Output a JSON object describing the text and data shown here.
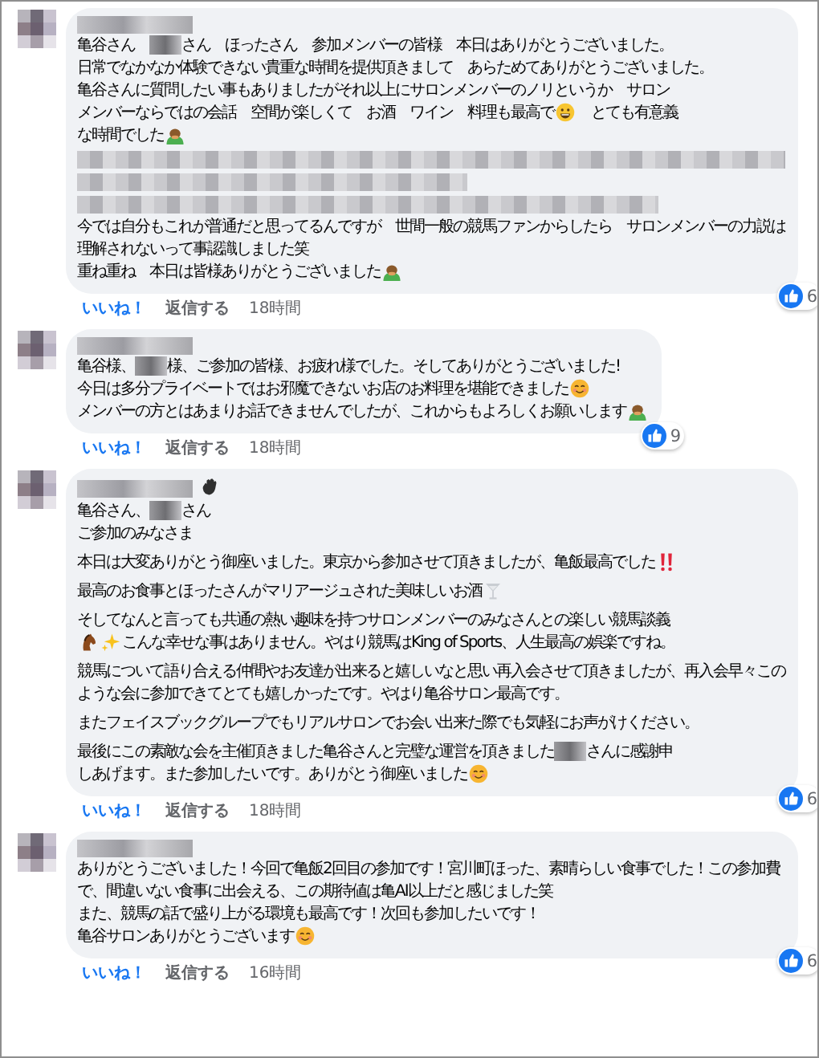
{
  "comments": [
    {
      "paragraphs": [
        [
          {
            "kind": "text",
            "segments": [
              {
                "kind": "text",
                "text": "亀谷さん　"
              },
              {
                "kind": "redacted"
              },
              {
                "kind": "text",
                "text": "さん　ほったさん　参加メンバーの皆様　本日はありがとうございました。"
              }
            ]
          },
          {
            "kind": "text",
            "segments": [
              {
                "kind": "text",
                "text": "日常でなかなか体験できない貴重な時間を提供頂きまして　あらためてありがとうございました。"
              }
            ]
          },
          {
            "kind": "text",
            "segments": [
              {
                "kind": "text",
                "text": "亀谷さんに質問したい事もありましたがそれ以上にサロンメンバーのノリというか　サロン"
              }
            ]
          },
          {
            "kind": "text",
            "segments": [
              {
                "kind": "text",
                "text": "メンバーならではの会話　空間が楽しくて　お酒　ワイン　料理も最高で"
              },
              {
                "kind": "grin"
              },
              {
                "kind": "text",
                "text": "　とても有意義"
              }
            ]
          },
          {
            "kind": "text",
            "segments": [
              {
                "kind": "text",
                "text": "な時間でした"
              },
              {
                "kind": "bow"
              }
            ]
          },
          {
            "kind": "redacted"
          },
          {
            "kind": "text",
            "segments": [
              {
                "kind": "text",
                "text": "今では自分もこれが普通だと思ってるんですが　世間一般の競馬ファンからしたら　サロンメンバーの力説は理解されないって事認識しました笑"
              }
            ]
          },
          {
            "kind": "text",
            "segments": [
              {
                "kind": "text",
                "text": "重ね重ね　本日は皆様ありがとうございました"
              },
              {
                "kind": "bow"
              }
            ]
          }
        ]
      ],
      "like": "いいね！",
      "reply": "返信する",
      "time": "18時間",
      "reactions": "6"
    },
    {
      "paragraphs": [
        [
          {
            "kind": "text",
            "segments": [
              {
                "kind": "text",
                "text": "亀谷様、"
              },
              {
                "kind": "redacted"
              },
              {
                "kind": "text",
                "text": "様、ご参加の皆様、お疲れ様でした。そしてありがとうございました!"
              }
            ]
          },
          {
            "kind": "text",
            "segments": [
              {
                "kind": "text",
                "text": "今日は多分プライベートではお邪魔できないお店のお料理を堪能できました"
              },
              {
                "kind": "smile"
              }
            ]
          },
          {
            "kind": "text",
            "segments": [
              {
                "kind": "text",
                "text": "メンバーの方とはあまりお話できませんでしたが、これからもよろしくお願いします"
              },
              {
                "kind": "bow"
              }
            ]
          }
        ]
      ],
      "like": "いいね！",
      "reply": "返信する",
      "time": "18時間",
      "reactions": "9"
    },
    {
      "author_badge": {
        "kind": "wave"
      },
      "paragraphs": [
        [
          {
            "kind": "text",
            "segments": [
              {
                "kind": "text",
                "text": "亀谷さん、"
              },
              {
                "kind": "redacted"
              },
              {
                "kind": "text",
                "text": "さん"
              }
            ]
          },
          {
            "kind": "text",
            "segments": [
              {
                "kind": "text",
                "text": "ご参加のみなさま"
              }
            ]
          }
        ],
        [
          {
            "kind": "text",
            "segments": [
              {
                "kind": "text",
                "text": "本日は大変ありがとう御座いました。東京から参加させて頂きましたが、亀飯最高でした"
              },
              {
                "kind": "exclaim"
              }
            ]
          }
        ],
        [
          {
            "kind": "text",
            "segments": [
              {
                "kind": "text",
                "text": "最高のお食事とほったさんがマリアージュされた美味しいお酒"
              },
              {
                "kind": "glass"
              }
            ]
          }
        ],
        [
          {
            "kind": "text",
            "segments": [
              {
                "kind": "text",
                "text": "そしてなんと言っても共通の熱い趣味を持つサロンメンバーのみなさんとの楽しい競馬談義"
              }
            ]
          },
          {
            "kind": "text",
            "segments": [
              {
                "kind": "horse"
              },
              {
                "kind": "sparkle"
              },
              {
                "kind": "text",
                "text": "こんな幸せな事はありません。やはり競馬はKing of Sports、人生最高の娯楽ですね。"
              }
            ]
          }
        ],
        [
          {
            "kind": "text",
            "segments": [
              {
                "kind": "text",
                "text": "競馬について語り合える仲間やお友達が出来ると嬉しいなと思い再入会させて頂きましたが、再入会早々このような会に参加できてとても嬉しかったです。やはり亀谷サロン最高です。"
              }
            ]
          }
        ],
        [
          {
            "kind": "text",
            "segments": [
              {
                "kind": "text",
                "text": "またフェイスブックグループでもリアルサロンでお会い出来た際でも気軽にお声がけください。"
              }
            ]
          }
        ],
        [
          {
            "kind": "text",
            "segments": [
              {
                "kind": "text",
                "text": "最後にこの素敵な会を主催頂きました亀谷さんと完璧な運営を頂きました"
              },
              {
                "kind": "redacted"
              },
              {
                "kind": "text",
                "text": "さんに感謝申"
              }
            ]
          },
          {
            "kind": "text",
            "segments": [
              {
                "kind": "text",
                "text": "しあげます。また参加したいです。ありがとう御座いました"
              },
              {
                "kind": "smile"
              }
            ]
          }
        ]
      ],
      "like": "いいね！",
      "reply": "返信する",
      "time": "18時間",
      "reactions": "6"
    },
    {
      "paragraphs": [
        [
          {
            "kind": "text",
            "segments": [
              {
                "kind": "text",
                "text": "ありがとうございました！今回で亀飯2回目の参加です！宮川町ほった、素晴らしい食事でした！この参加費で、間違いない食事に出会える、この期待値は亀AI以上だと感じました笑"
              }
            ]
          },
          {
            "kind": "text",
            "segments": [
              {
                "kind": "text",
                "text": "また、競馬の話で盛り上がる環境も最高です！次回も参加したいです！"
              }
            ]
          },
          {
            "kind": "text",
            "segments": [
              {
                "kind": "text",
                "text": "亀谷サロンありがとうございます"
              },
              {
                "kind": "smile"
              }
            ]
          }
        ]
      ],
      "like": "いいね！",
      "reply": "返信する",
      "time": "16時間",
      "reactions": "6"
    }
  ]
}
